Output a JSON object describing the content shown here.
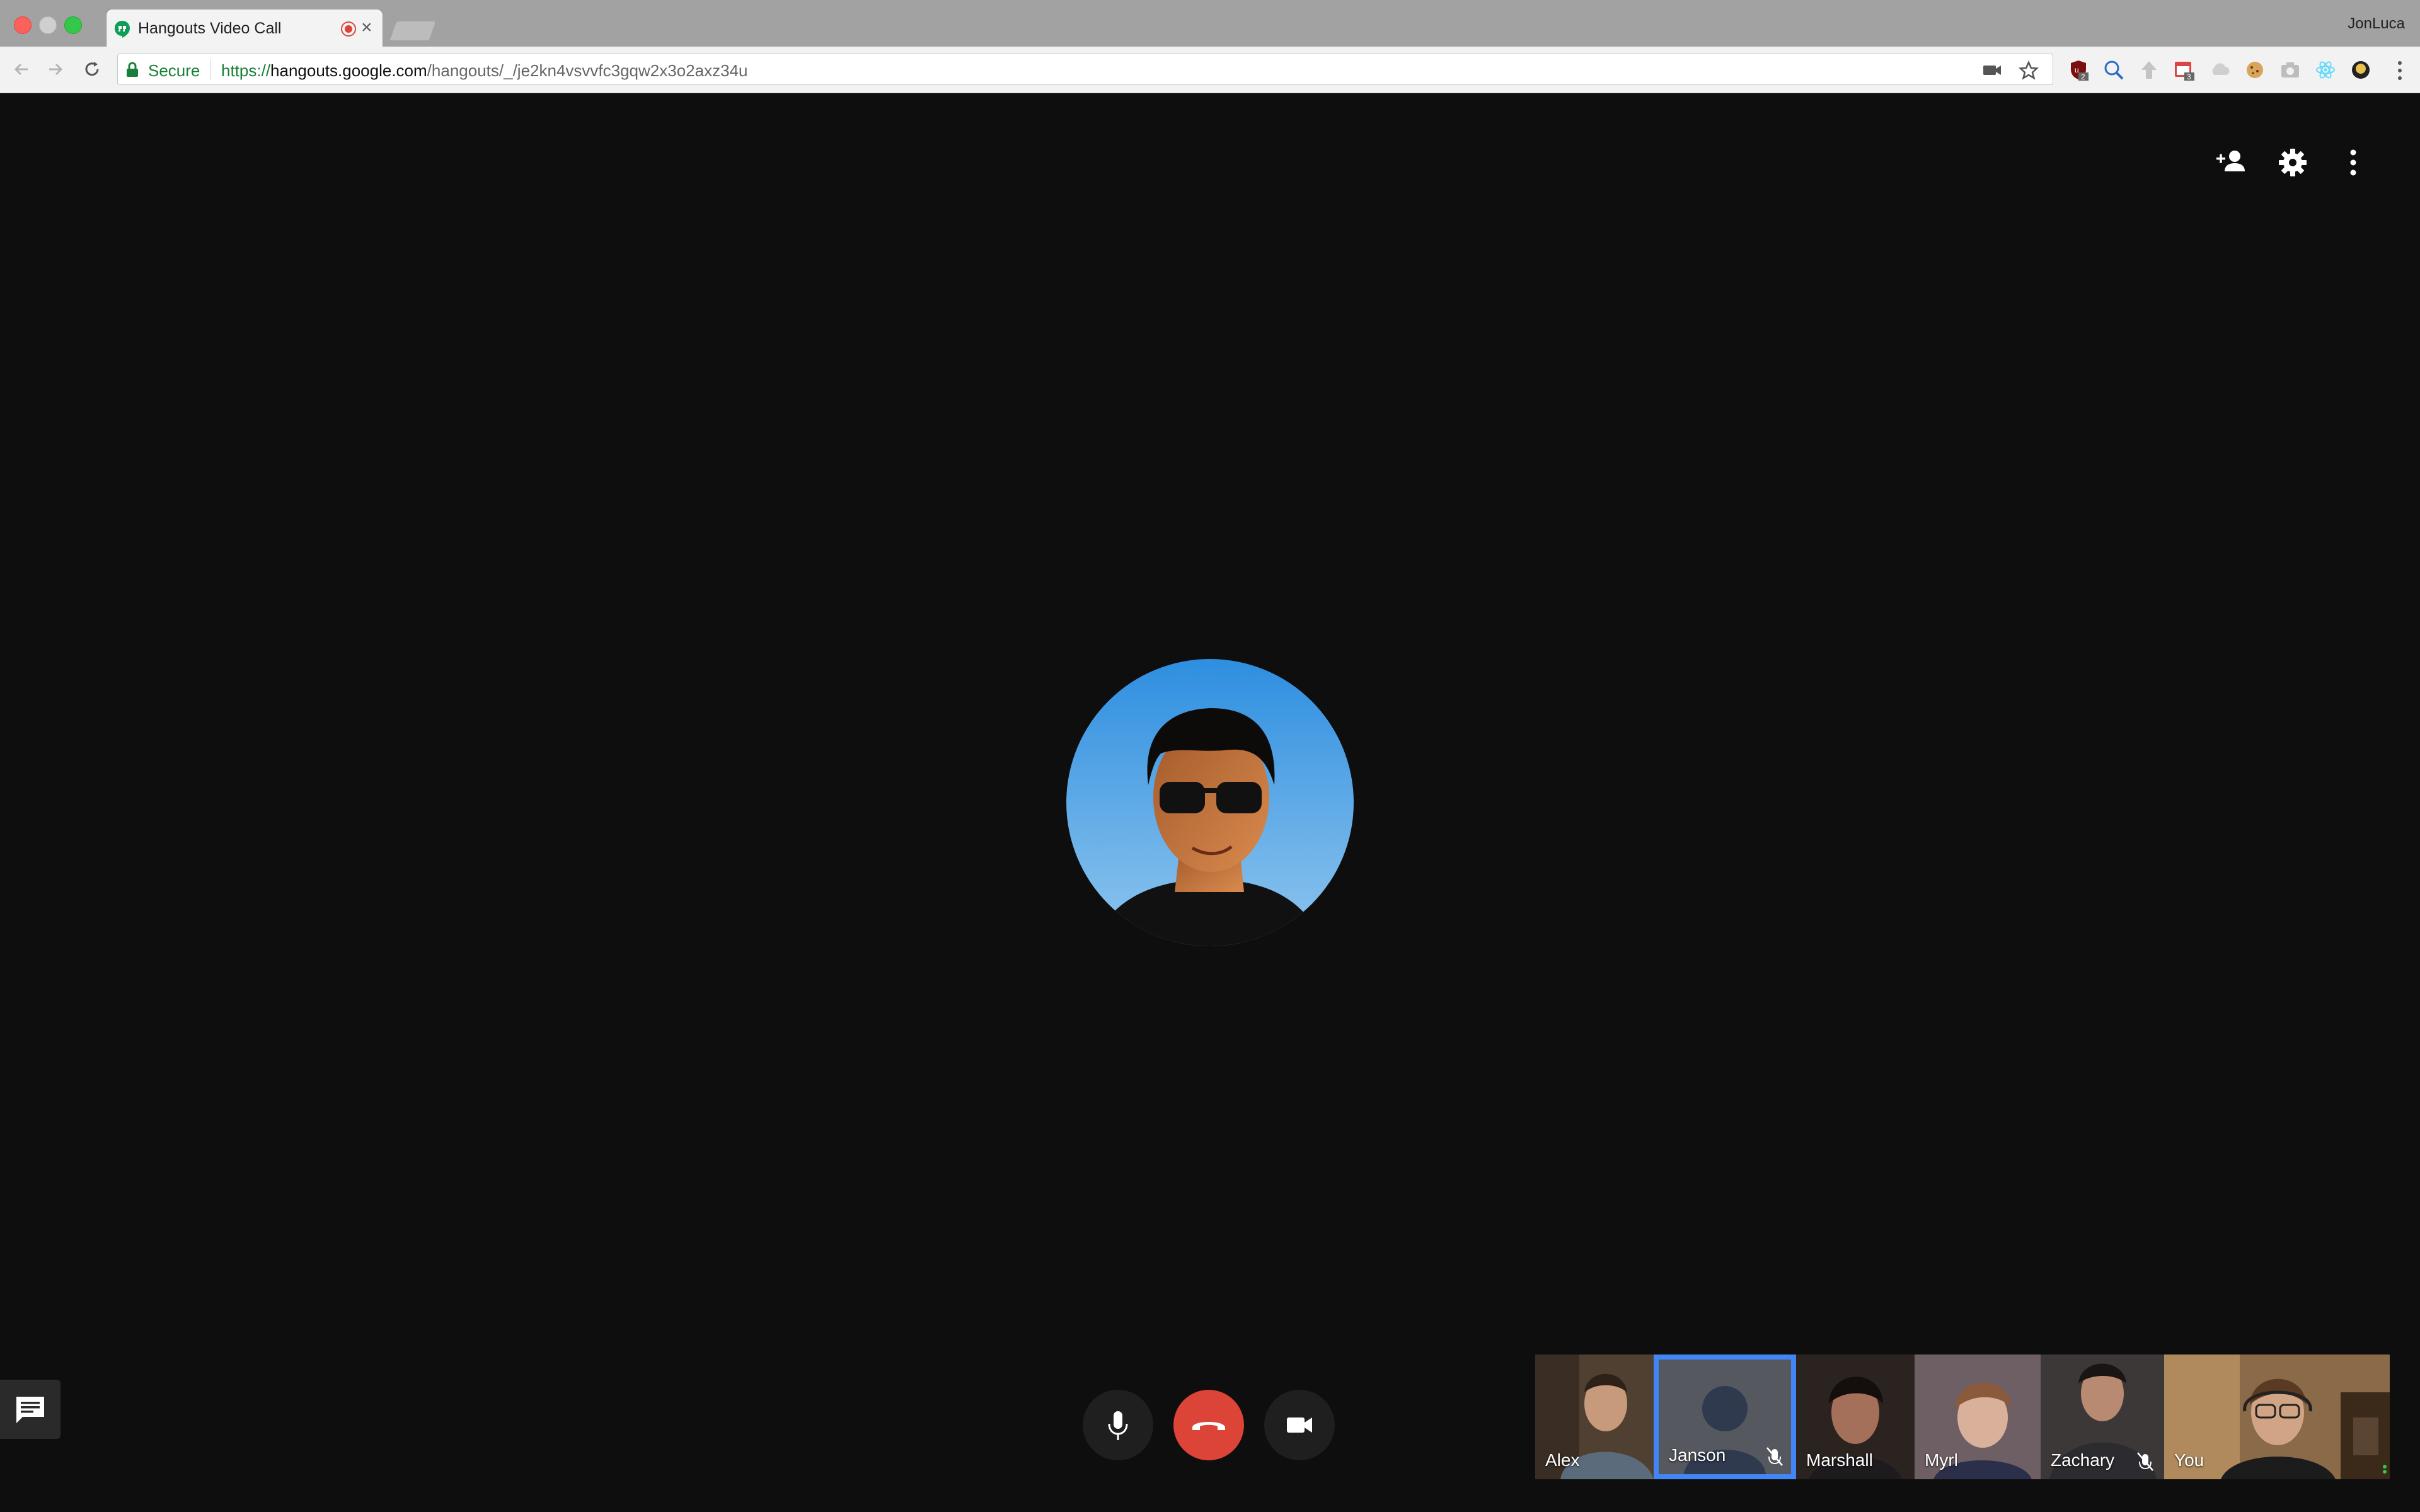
{
  "browser": {
    "tab": {
      "title": "Hangouts Video Call"
    },
    "profile_name": "JonLuca",
    "omnibox": {
      "secure_label": "Secure",
      "url_scheme": "https://",
      "url_host": "hangouts.google.com",
      "url_path": "/hangouts/_/je2kn4vsvvfc3gqw2x3o2axz34u"
    },
    "extensions": [
      {
        "name": "ublock-extension-icon",
        "badge": "2"
      },
      {
        "name": "magnifier-extension-icon"
      },
      {
        "name": "upload-extension-icon"
      },
      {
        "name": "calendar-extension-icon",
        "badge": "3"
      },
      {
        "name": "cloud-extension-icon"
      },
      {
        "name": "cookie-extension-icon"
      },
      {
        "name": "camera-extension-icon"
      },
      {
        "name": "react-extension-icon"
      },
      {
        "name": "profile-extension-icon"
      }
    ]
  },
  "call": {
    "top_actions": [
      "add-person-icon",
      "settings-icon",
      "more-vert-icon"
    ],
    "controls": [
      "microphone-icon",
      "hangup-icon",
      "videocam-icon"
    ],
    "chat_icon": "chat-icon",
    "accent_color": "#4285f4",
    "hangup_color": "#db4437",
    "participants": [
      {
        "name": "Alex",
        "muted": false
      },
      {
        "name": "Janson",
        "muted": true,
        "active": true
      },
      {
        "name": "Marshall",
        "muted": false
      },
      {
        "name": "Myrl",
        "muted": false
      },
      {
        "name": "Zachary",
        "muted": true
      },
      {
        "name": "You",
        "muted": false
      }
    ]
  }
}
